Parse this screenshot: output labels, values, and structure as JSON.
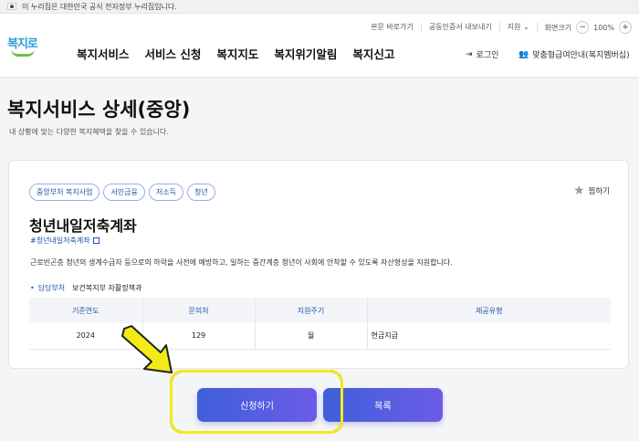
{
  "gov_banner": "이 누리집은 대한민국 공식 전자정부 누리집입니다.",
  "util": {
    "skip": "본문 바로가기",
    "cert": "공동인증서 내보내기",
    "support": "지원",
    "screen_size": "화면크기",
    "zoom_minus": "−",
    "zoom_value": "100%",
    "zoom_plus": "+"
  },
  "logo": {
    "text": "복지로"
  },
  "gnb": [
    "복지서비스",
    "서비스 신청",
    "복지지도",
    "복지위기알림",
    "복지신고"
  ],
  "login": "로그인",
  "mypage": "맞춤형급여안내(복지멤버십)",
  "page": {
    "title": "복지서비스 상세(중앙)",
    "subtitle": "내 상황에 맞는 다양한 복지혜택을 찾을 수 있습니다."
  },
  "service": {
    "tags": [
      "중앙부처 복지사업",
      "서민금융",
      "저소득",
      "청년"
    ],
    "fav": "찜하기",
    "title": "청년내일저축계좌",
    "hashtag": "#청년내일저축계좌",
    "description": "근로빈곤층 청년의 생계수급자 등으로의 하락을 사전에 예방하고, 일하는 중간계층 청년이 사회에 안착할 수 있도록 자산형성을 지원합니다.",
    "dept_label": "담당부처",
    "dept_value": "보건복지부 자활정책과",
    "table": {
      "headers": [
        "기준연도",
        "문의처",
        "지원주기",
        "제공유형"
      ],
      "row": [
        "2024",
        "129",
        "월",
        "현금지급"
      ]
    }
  },
  "buttons": {
    "apply": "신청하기",
    "list": "목록"
  },
  "colors": {
    "accent": "#2450a8",
    "button_start": "#3f5fd9",
    "button_end": "#6b5ce8",
    "highlight": "#f3ea18"
  }
}
